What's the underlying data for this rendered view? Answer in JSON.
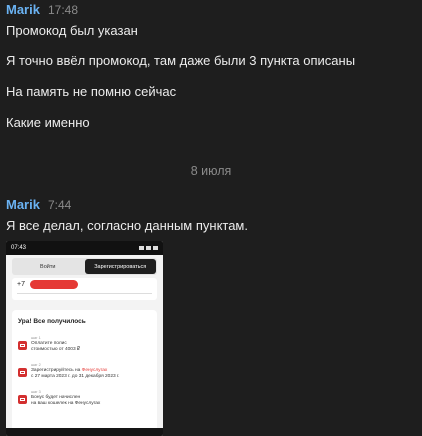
{
  "messages": [
    {
      "author": "Marik",
      "time": "17:48",
      "lines": [
        "Промокод был указан",
        "Я точно ввёл промокод, там даже были 3 пункта описаны",
        "На память не помню сейчас",
        "Какие именно"
      ]
    },
    {
      "author": "Marik",
      "time": "7:44",
      "lines": [
        "Я все делал, согласно данным пунктам."
      ]
    }
  ],
  "date_separator": "8 июля",
  "attachment": {
    "status_time": "07:43",
    "tabs": [
      "Войти",
      "Зарегистрироваться"
    ],
    "phone_prefix": "+7",
    "success_title": "Ура! Все получилось",
    "steps": [
      {
        "label": "шаг 1",
        "text": "Оплатите полис",
        "text2": "стоимостью от 4003 ₽"
      },
      {
        "label": "шаг 2",
        "text": "Зарегистрируйтесь на",
        "link": "Фенуслугах",
        "text2": "с 27 марта 2023 г. до 31 декабря 2023 г."
      },
      {
        "label": "шаг 3",
        "text": "Бонус будет начислен",
        "text2": "на ваш кошелек на Фенуслугах"
      }
    ]
  },
  "colors": {
    "background": "#1e1e1e",
    "author": "#6ab2f2",
    "muted": "#8a8a8a",
    "accent_red": "#e53935"
  }
}
